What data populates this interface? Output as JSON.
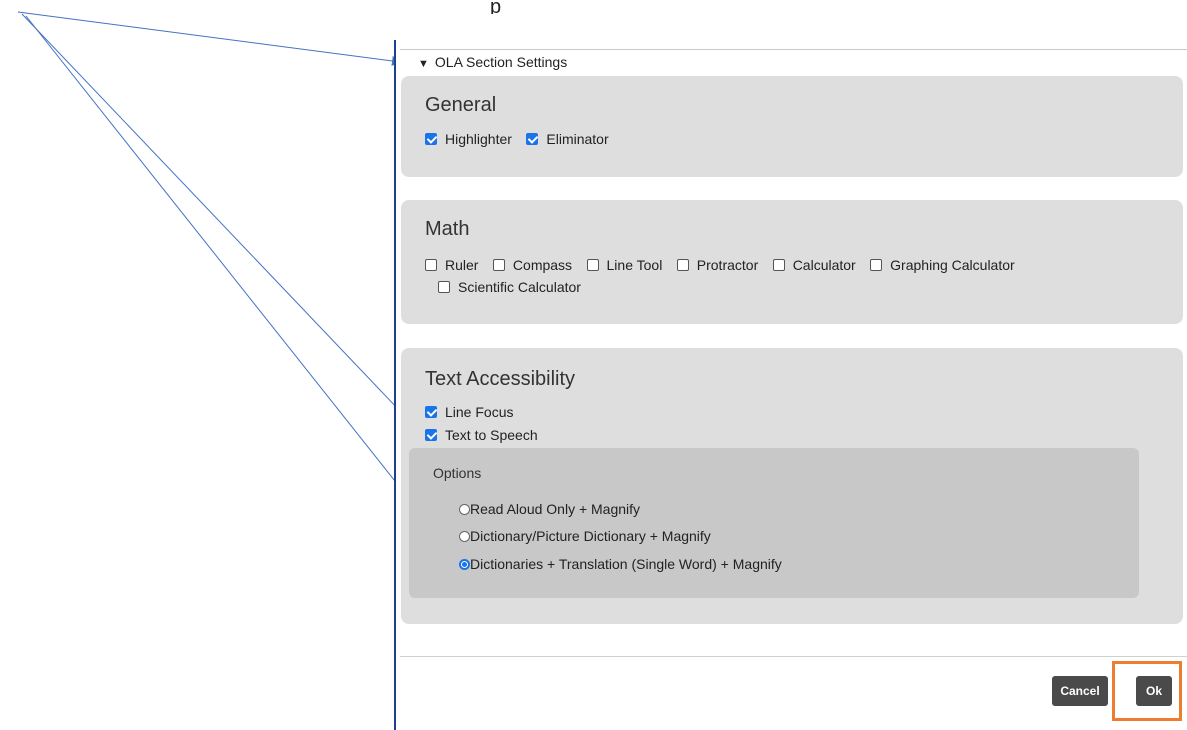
{
  "top_stub_text": "p",
  "section": {
    "toggle_icon": "triangle-down-icon",
    "title": "OLA Section Settings"
  },
  "general": {
    "title": "General",
    "tools": [
      {
        "label": "Highlighter",
        "checked": true
      },
      {
        "label": "Eliminator",
        "checked": true
      }
    ]
  },
  "math": {
    "title": "Math",
    "tools": [
      {
        "label": "Ruler",
        "checked": false
      },
      {
        "label": "Compass",
        "checked": false
      },
      {
        "label": "Line Tool",
        "checked": false
      },
      {
        "label": "Protractor",
        "checked": false
      },
      {
        "label": "Calculator",
        "checked": false
      },
      {
        "label": "Graphing Calculator",
        "checked": false
      },
      {
        "label": "Scientific Calculator",
        "checked": false
      }
    ]
  },
  "text_accessibility": {
    "title": "Text Accessibility",
    "tools": [
      {
        "label": "Line Focus",
        "checked": true
      },
      {
        "label": "Text to Speech",
        "checked": true
      }
    ],
    "options": {
      "label": "Options",
      "choices": [
        {
          "label": "Read Aloud Only + Magnify",
          "selected": false
        },
        {
          "label": "Dictionary/Picture Dictionary + Magnify",
          "selected": false
        },
        {
          "label": "Dictionaries + Translation (Single Word) + Magnify",
          "selected": true
        }
      ]
    }
  },
  "footer": {
    "cancel_label": "Cancel",
    "ok_label": "Ok"
  },
  "colors": {
    "checkbox_accent": "#1a73e8",
    "annotation_arrow": "#4472c4",
    "highlight_box": "#ed7d31",
    "panel_bg": "#dedede",
    "options_bg": "#c8c8c8",
    "button_bg": "#4a4a4a"
  }
}
